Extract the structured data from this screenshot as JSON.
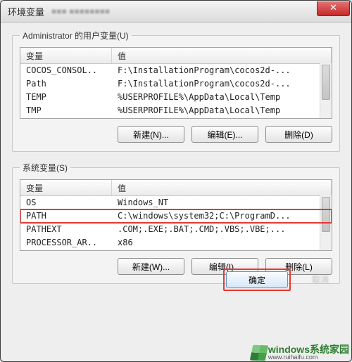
{
  "window": {
    "title": "环境变量",
    "blurred_subtitle": "■■■ ■■■■■■■■",
    "close_label": "✕"
  },
  "user_group": {
    "legend": "Administrator 的用户变量(U)",
    "header_name": "变量",
    "header_value": "值",
    "rows": [
      {
        "name": "COCOS_CONSOL..",
        "value": "F:\\InstallationProgram\\cocos2d-..."
      },
      {
        "name": "Path",
        "value": "F:\\InstallationProgram\\cocos2d-..."
      },
      {
        "name": "TEMP",
        "value": "%USERPROFILE%\\AppData\\Local\\Temp"
      },
      {
        "name": "TMP",
        "value": "%USERPROFILE%\\AppData\\Local\\Temp"
      }
    ],
    "buttons": {
      "new": "新建(N)...",
      "edit": "编辑(E)...",
      "delete": "删除(D)"
    }
  },
  "system_group": {
    "legend": "系统变量(S)",
    "header_name": "变量",
    "header_value": "值",
    "rows": [
      {
        "name": "OS",
        "value": "Windows_NT"
      },
      {
        "name": "PATH",
        "value": "C:\\windows\\system32;C:\\ProgramD...",
        "highlight": true
      },
      {
        "name": "PATHEXT",
        "value": ".COM;.EXE;.BAT;.CMD;.VBS;.VBE;..."
      },
      {
        "name": "PROCESSOR_AR..",
        "value": "x86"
      }
    ],
    "buttons": {
      "new": "新建(W)...",
      "edit": "编辑(I)...",
      "delete": "删除(L)"
    }
  },
  "bottom": {
    "ok": "确定",
    "cancel": "取消"
  },
  "watermark": {
    "top": "windows系统家园",
    "sub": "www.ruihaifu.com"
  }
}
